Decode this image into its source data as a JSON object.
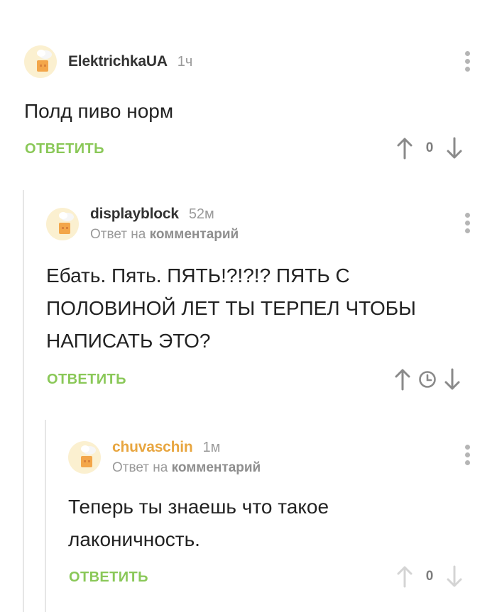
{
  "comments": [
    {
      "username": "ElektrichkaUA",
      "time": "1ч",
      "reply_prefix": "",
      "reply_target": "",
      "text_lines": [
        "Полд пиво норм"
      ],
      "reply_label": "ОТВЕТИТЬ",
      "score": "0",
      "username_color": "#333333"
    },
    {
      "username": "displayblock",
      "time": "52м",
      "reply_prefix": "Ответ на",
      "reply_target": "комментарий",
      "text_lines": [
        "Ебать. Пять. ПЯТЬ!?!?!? ПЯТЬ С",
        "ПОЛОВИНОЙ ЛЕТ ТЫ ТЕРПЕЛ ЧТОБЫ",
        "НАПИСАТЬ ЭТО?"
      ],
      "reply_label": "ОТВЕТИТЬ",
      "score": "",
      "score_icon": "clock-icon",
      "username_color": "#333333"
    },
    {
      "username": "chuvaschin",
      "time": "1м",
      "reply_prefix": "Ответ на",
      "reply_target": "комментарий",
      "text_lines": [
        "Теперь ты знаешь что такое",
        "лаконичность."
      ],
      "reply_label": "ОТВЕТИТЬ",
      "score": "0",
      "username_color": "#e8a640"
    }
  ],
  "colors": {
    "reply_green": "#8ac858",
    "muted_gray": "#9a9a9a",
    "author_orange": "#e8a640"
  },
  "icons": [
    "avatar-cook-icon",
    "more-dots-icon",
    "upvote-arrow-icon",
    "downvote-arrow-icon",
    "clock-icon"
  ]
}
